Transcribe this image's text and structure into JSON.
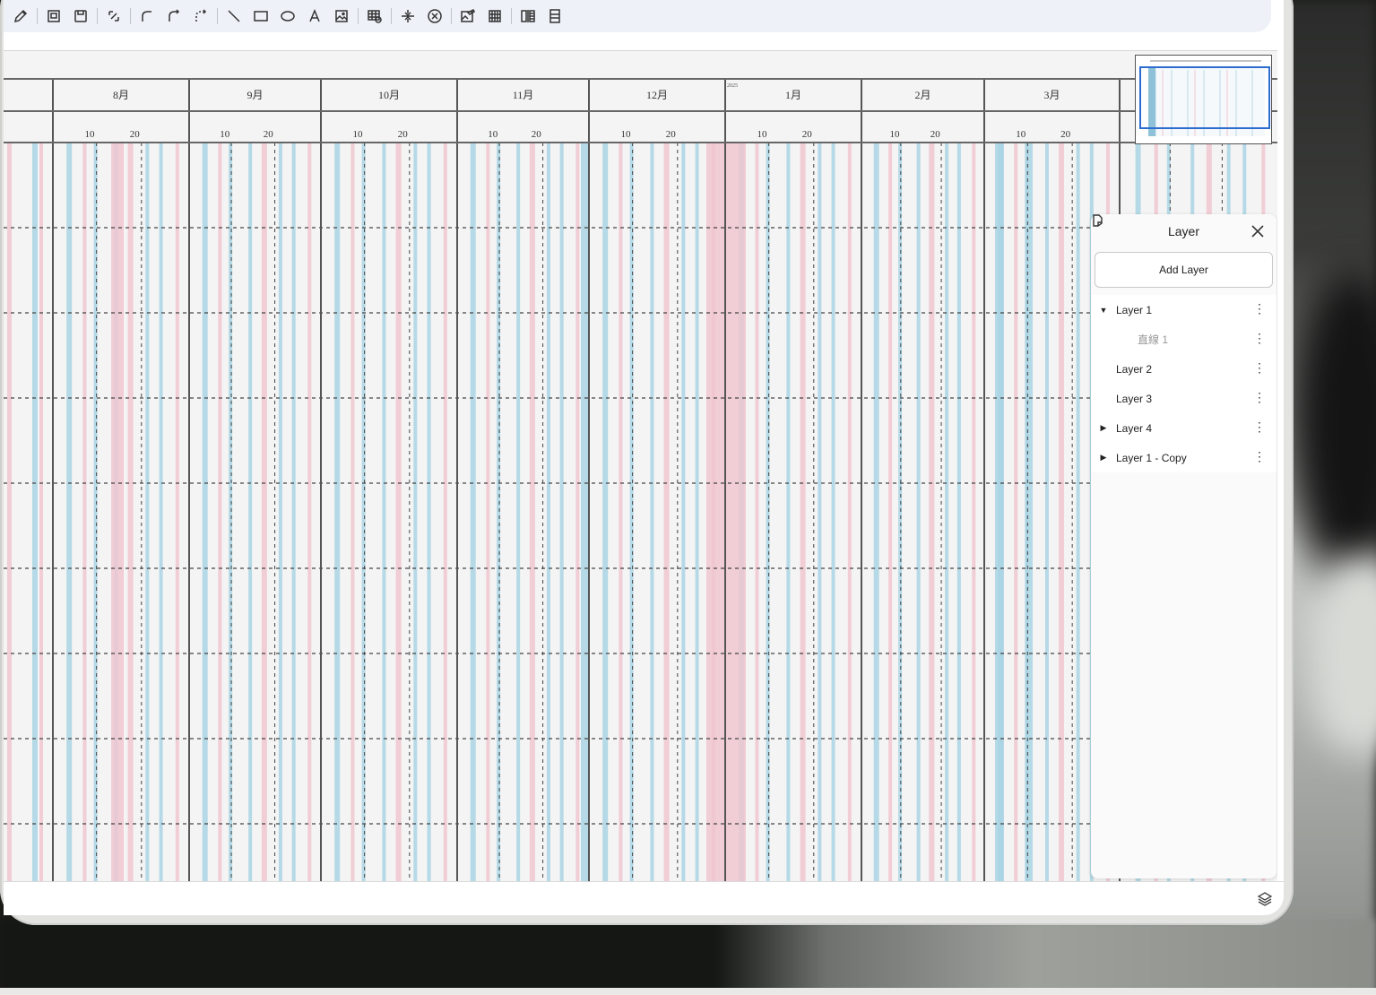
{
  "toolbar": {
    "tools": [
      "pencil-icon",
      "image-frame-icon",
      "save-frame-icon",
      "transform-icon",
      "curve-icon",
      "curve-arrow-icon",
      "dashed-curve-icon",
      "line-icon",
      "rectangle-icon",
      "ellipse-icon",
      "text-icon",
      "image-icon",
      "table-icon",
      "split-icon",
      "cancel-icon",
      "photo-edit-icon",
      "column-grid-icon",
      "align-columns-icon",
      "stack-icon"
    ]
  },
  "gantt": {
    "months": [
      "8月",
      "9月",
      "10月",
      "11月",
      "12月",
      "1月",
      "2月",
      "3月"
    ],
    "day_ticks": [
      "10",
      "20"
    ],
    "year_marker": "2025"
  },
  "layer_panel": {
    "title": "Layer",
    "add_label": "Add Layer",
    "items": [
      {
        "label": "Layer 1",
        "caret": "▼",
        "child": false
      },
      {
        "label": "直線 1",
        "caret": "",
        "child": true
      },
      {
        "label": "Layer 2",
        "caret": "",
        "child": false
      },
      {
        "label": "Layer 3",
        "caret": "",
        "child": false
      },
      {
        "label": "Layer 4",
        "caret": "▶",
        "child": false
      },
      {
        "label": "Layer 1 - Copy",
        "caret": "▶",
        "child": false
      }
    ]
  },
  "colors": {
    "accent": "#2d6ccf",
    "stripe_blue": "#a9d3e3",
    "stripe_pink": "#f0c6cf",
    "grid_line": "#555555"
  }
}
